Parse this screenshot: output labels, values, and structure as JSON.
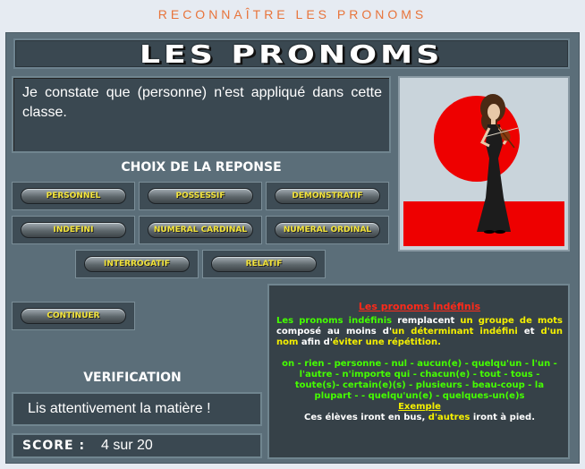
{
  "header": {
    "title": "RECONNAÎTRE LES PRONOMS"
  },
  "banner": {
    "title": "LES PRONOMS"
  },
  "question": {
    "text": "Je constate que (personne) n'est appliqué dans cette classe."
  },
  "choices": {
    "title": "CHOIX DE LA REPONSE",
    "personnel": "PERSONNEL",
    "possessif": "POSSESSIF",
    "demonstratif": "DEMONSTRATIF",
    "indefini": "INDEFINI",
    "numeral_cardinal": "NUMERAL CARDINAL",
    "numeral_ordinal": "NUMERAL ORDINAL",
    "interrogatif": "INTERROGATIF",
    "relatif": "RELATIF"
  },
  "continue_button": "CONTINUER",
  "verification": {
    "title": "VERIFICATION",
    "message": "Lis attentivement la matière !"
  },
  "score": {
    "label": "SCORE :",
    "value": "4 sur 20"
  },
  "info": {
    "title": "Les pronoms indéfinis",
    "p1": "Les pronoms indéfinis",
    "p2": " remplacent ",
    "p3": "un groupe de mots",
    "p4": " composé au moins d'",
    "p5": "un déterminant indéfini",
    "p6": " et ",
    "p7": "d'un nom",
    "p8": " afin d'",
    "p9": "éviter une répétition.",
    "list": "on - rien - personne - nul - aucun(e) - quelqu'un - l'un - l'autre - n'importe qui - chacun(e) - tout - tous - toute(s)- certain(e)(s) - plusieurs - beau-coup - la plupart - - quelqu'un(e) - quelques-un(e)s",
    "example_label": "Exemple",
    "ex1": "Ces élèves iront en bus, ",
    "ex2": "d'autres",
    "ex3": " iront à pied."
  },
  "colors": {
    "accent_orange": "#e8743b",
    "panel": "#3a4851",
    "highlight_green": "#45ff00",
    "highlight_yellow": "#f5f000",
    "title_red": "#ff2a1a",
    "button_text": "#f3e43a"
  },
  "illustration": {
    "subject": "woman-violinist-icon"
  }
}
